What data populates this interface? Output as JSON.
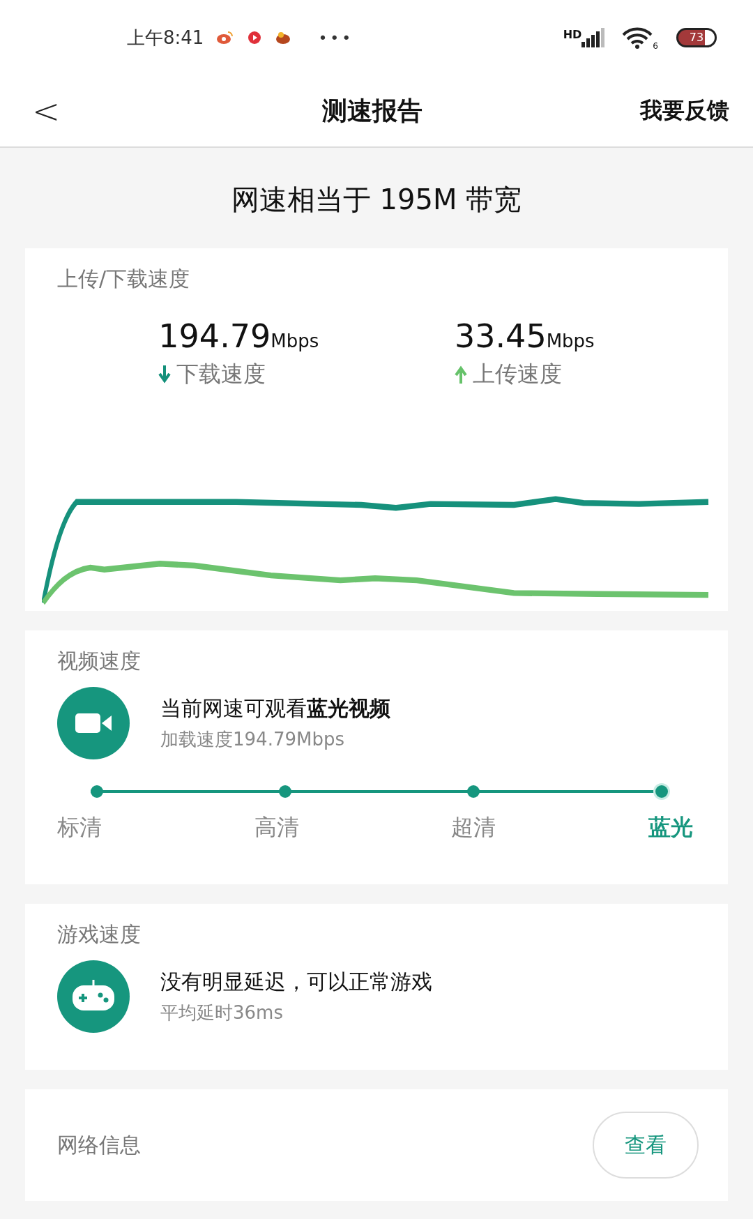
{
  "status_bar": {
    "time": "上午8:41",
    "more": "•••",
    "network": "HD",
    "wifi_badge": "6",
    "battery": "73"
  },
  "header": {
    "back": "<",
    "title": "测速报告",
    "action": "我要反馈"
  },
  "headline": "网速相当于 195M 带宽",
  "speed_card": {
    "title": "上传/下载速度",
    "metrics": [
      {
        "kind": "download",
        "value": "194.79",
        "unit": "Mbps",
        "label": "下载速度"
      },
      {
        "kind": "upload",
        "value": "33.45",
        "unit": "Mbps",
        "label": "上传速度"
      }
    ]
  },
  "video_card": {
    "title": "视频速度",
    "message": "当前网速可观看**蓝光视频**",
    "detail": "加载速度194.79Mbps",
    "levels": [
      {
        "label": "标清",
        "selected": false
      },
      {
        "label": "高清",
        "selected": false
      },
      {
        "label": "超清",
        "selected": false
      },
      {
        "label": "蓝光",
        "selected": true
      }
    ]
  },
  "game_card": {
    "title": "游戏速度",
    "message": "没有明显延迟，可以正常游戏",
    "detail": "平均延时36ms"
  },
  "network_card": {
    "title": "网络信息",
    "button": "查看"
  }
}
